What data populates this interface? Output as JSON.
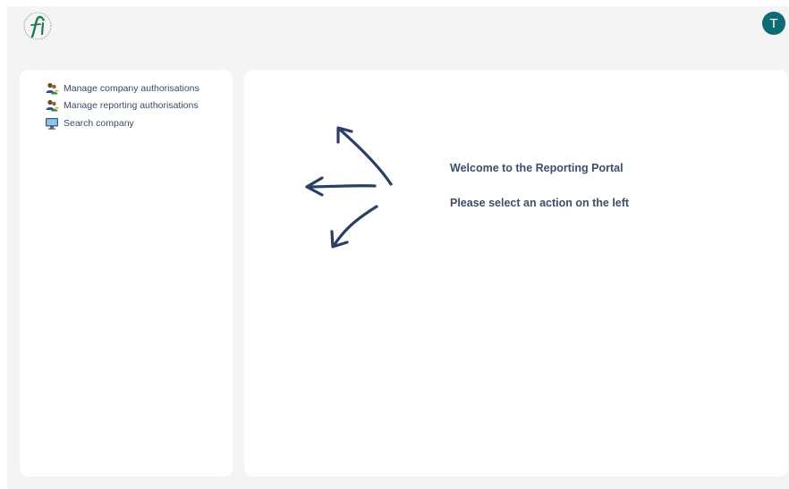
{
  "header": {
    "logo_icon": "fi-seal-logo-icon",
    "user_avatar_initial": "T",
    "avatar_color": "#0e6b73"
  },
  "sidebar": {
    "items": [
      {
        "label": "Manage company authorisations",
        "icon": "users-key-icon"
      },
      {
        "label": "Manage reporting authorisations",
        "icon": "users-key-icon"
      },
      {
        "label": "Search company",
        "icon": "monitor-search-icon"
      }
    ]
  },
  "main": {
    "welcome_text": "Welcome to the Reporting Portal",
    "instruction_text": "Please select an action on the left",
    "arrows_icon": "pointing-left-arrows-icon",
    "text_color": "#3f4d68"
  }
}
